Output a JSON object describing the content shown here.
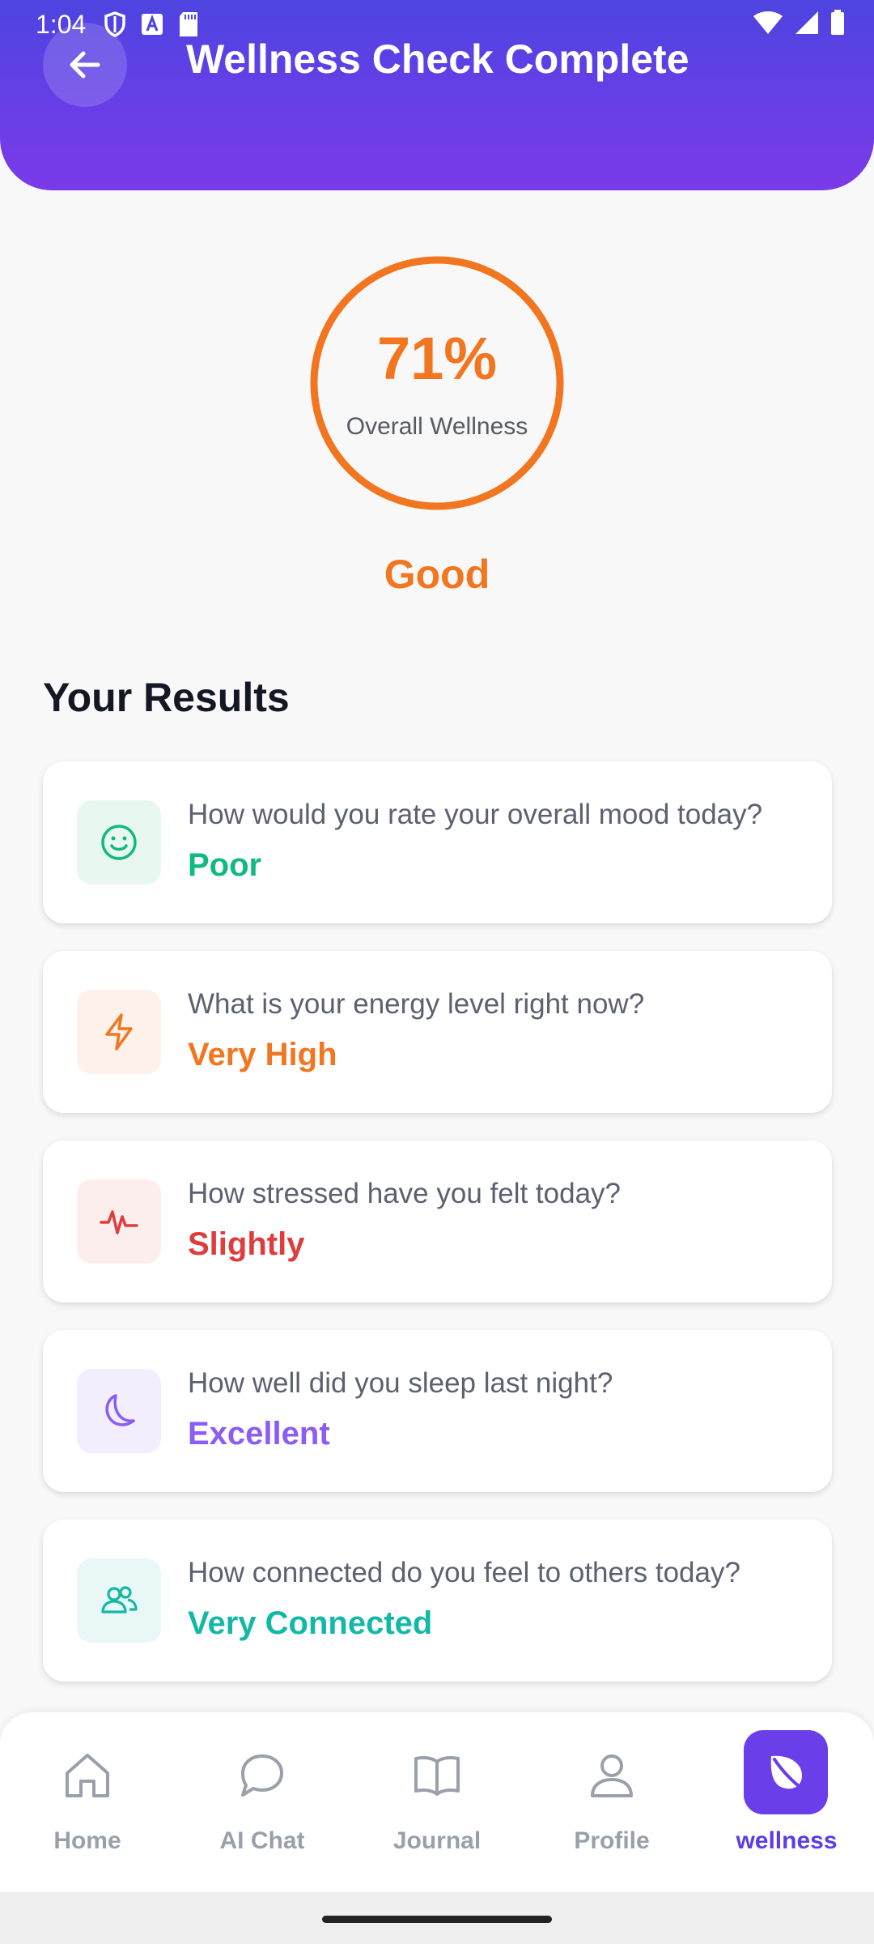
{
  "status_bar": {
    "time": "1:04",
    "left_icons": [
      "shield-icon",
      "text-a-icon",
      "sd-card-icon"
    ],
    "right_icons": [
      "wifi-icon",
      "signal-icon",
      "battery-icon"
    ]
  },
  "header": {
    "title": "Wellness Check Complete",
    "back_icon": "back-arrow-icon"
  },
  "score": {
    "percent_text": "71%",
    "percent_value": 71,
    "caption": "Overall Wellness",
    "rating": "Good",
    "color": "#f27620"
  },
  "results": {
    "title": "Your Results",
    "items": [
      {
        "question": "How would you rate your overall mood today?",
        "answer": "Poor",
        "icon": "smile-icon",
        "color": "#10b981",
        "bg": "#e8f8f1"
      },
      {
        "question": "What is your energy level right now?",
        "answer": "Very High",
        "icon": "lightning-icon",
        "color": "#f27620",
        "bg": "#fef1ea"
      },
      {
        "question": "How stressed have you felt today?",
        "answer": "Slightly",
        "icon": "pulse-icon",
        "color": "#e03c3c",
        "bg": "#fdeeee"
      },
      {
        "question": "How well did you sleep last night?",
        "answer": "Excellent",
        "icon": "moon-icon",
        "color": "#8b5cf6",
        "bg": "#f2eefe"
      },
      {
        "question": "How connected do you feel to others today?",
        "answer": "Very Connected",
        "icon": "users-icon",
        "color": "#14b8a6",
        "bg": "#e9f8f6"
      }
    ]
  },
  "nav": {
    "items": [
      {
        "label": "Home",
        "icon": "home-icon"
      },
      {
        "label": "AI Chat",
        "icon": "chat-icon"
      },
      {
        "label": "Journal",
        "icon": "book-icon"
      },
      {
        "label": "Profile",
        "icon": "user-icon"
      },
      {
        "label": "wellness",
        "icon": "leaf-icon",
        "active": true
      }
    ],
    "inactive_color": "#9aa0ab",
    "active_color": "#5b3de6"
  }
}
